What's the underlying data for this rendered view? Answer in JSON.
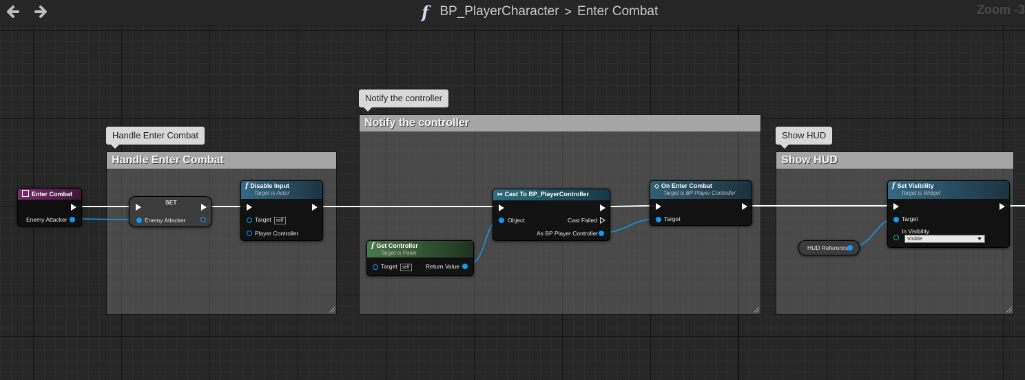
{
  "toolbar": {
    "function_glyph": "f",
    "breadcrumb_parent": "BP_PlayerCharacter",
    "breadcrumb_separator": ">",
    "breadcrumb_current": "Enter Combat",
    "zoom_text": "Zoom -3"
  },
  "comments": {
    "handle": {
      "bubble": "Handle Enter Combat",
      "title": "Handle Enter Combat"
    },
    "notify": {
      "bubble": "Notify the controller",
      "title": "Notify the controller"
    },
    "hud": {
      "bubble": "Show HUD",
      "title": "Show HUD"
    }
  },
  "nodes": {
    "enter_combat": {
      "title": "Enter Combat",
      "pin": "Enemy Attacker"
    },
    "set": {
      "title": "SET",
      "pin": "Enemy Attacker"
    },
    "disable_input": {
      "glyph": "f",
      "title": "Disable Input",
      "subtitle": "Target is Actor",
      "target": "Target",
      "self": "self",
      "controller": "Player Controller"
    },
    "get_controller": {
      "glyph": "f",
      "title": "Get Controller",
      "subtitle": "Target is Pawn",
      "target": "Target",
      "self": "self",
      "return": "Return Value"
    },
    "cast": {
      "title": "Cast To BP_PlayerController",
      "object": "Object",
      "failed": "Cast Failed",
      "as": "As BP Player Controller"
    },
    "on_enter_combat": {
      "title": "On Enter Combat",
      "subtitle": "Target is BP Player Controller",
      "target": "Target"
    },
    "hud_ref": {
      "title": "HUD Reference"
    },
    "set_visibility": {
      "glyph": "f",
      "title": "Set Visibility",
      "subtitle": "Target is Widget",
      "target": "Target",
      "in_visibility": "In Visibility",
      "visibility_value": "Visible"
    }
  },
  "colors": {
    "event_header": "#6a2a5e",
    "function_header": "#2f5f78",
    "pure_header": "#3d5e3d",
    "object_pin": "#109cf0",
    "comment_title_bg": "#a5a5a5"
  }
}
